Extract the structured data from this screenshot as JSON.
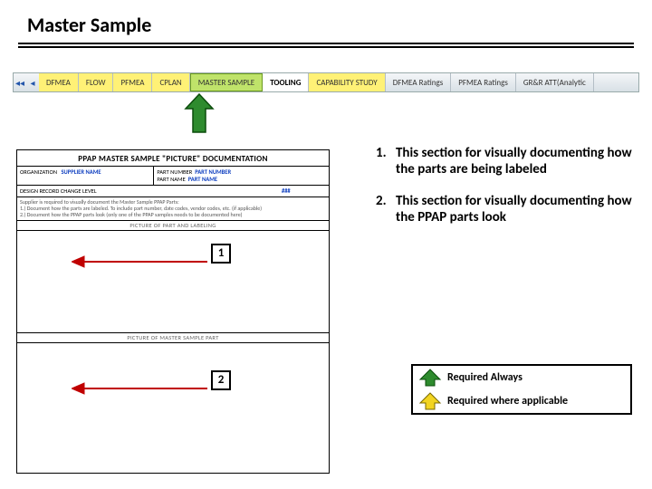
{
  "title": "Master Sample",
  "tabs": {
    "t0": "DFMEA",
    "t1": "FLOW",
    "t2": "PFMEA",
    "t3": "CPLAN",
    "t4": "MASTER SAMPLE",
    "t5": "TOOLING",
    "t6": "CAPABILITY STUDY",
    "t7": "DFMEA Ratings",
    "t8": "PFMEA Ratings",
    "t9": "GR&R ATT(Analytic"
  },
  "form": {
    "title": "PPAP MASTER SAMPLE \"PICTURE\" DOCUMENTATION",
    "org_label": "ORGANIZATION",
    "supplier": "SUPPLIER NAME",
    "partnum_label": "PART NUMBER",
    "partnum": "PART NUMBER",
    "partname_label": "PART NAME",
    "partname": "PART NAME",
    "design_label": "DESIGN RECORD CHANGE LEVEL",
    "rev": "###",
    "instr_line0": "Supplier is required to visually document the Master Sample PPAP Parts:",
    "instr_line1": "1.) Document how the parts are labeled. To include part number, date codes, vendor codes, etc. (if applicable)",
    "instr_line2": "2.) Document how the PPAP parts look (only one of the PPAP samples needs to be documented here)",
    "bar1": "PICTURE OF PART AND LABELING",
    "bar2": "PICTURE OF MASTER SAMPLE PART"
  },
  "callouts": {
    "c1": "1",
    "c2": "2"
  },
  "bullets": {
    "n1": "1.",
    "t1": "This section for visually documenting how the parts are being labeled",
    "n2": "2.",
    "t2": "This section for visually documenting how the PPAP parts look"
  },
  "legend": {
    "always": "Required Always",
    "applicable": "Required where applicable"
  }
}
